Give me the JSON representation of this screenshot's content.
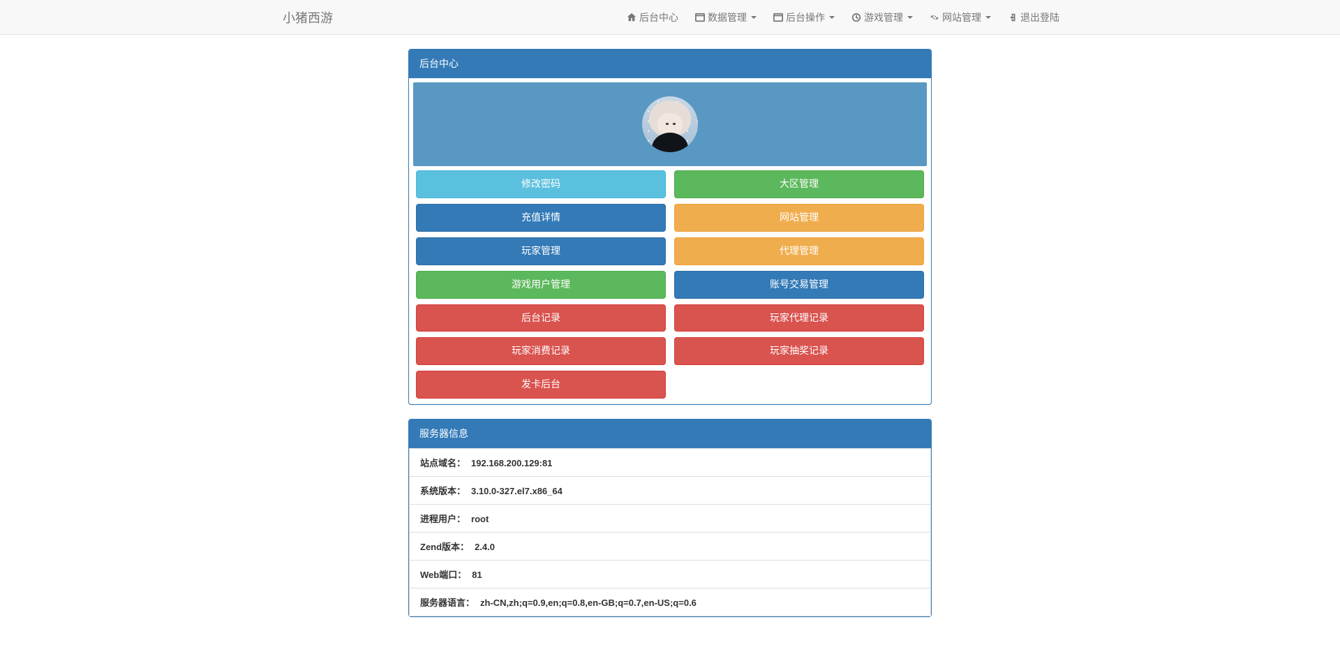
{
  "brand": "小猪西游",
  "nav": {
    "home": "后台中心",
    "data": "数据管理",
    "ops": "后台操作",
    "game": "游戏管理",
    "site": "网站管理",
    "logout": "退出登陆"
  },
  "panel1_title": "后台中心",
  "buttons": {
    "change_pw": "修改密码",
    "zone_mgmt": "大区管理",
    "recharge": "充值详情",
    "site_mgmt": "网站管理",
    "player_mgmt": "玩家管理",
    "agent_mgmt": "代理管理",
    "game_user_mgmt": "游戏用户管理",
    "acct_trade": "账号交易管理",
    "backend_log": "后台记录",
    "player_agent_log": "玩家代理记录",
    "player_consume_log": "玩家消费记录",
    "player_lottery_log": "玩家抽奖记录",
    "card_backend": "发卡后台"
  },
  "server_panel_title": "服务器信息",
  "server": {
    "rows": [
      {
        "label": "站点域名：",
        "value": "192.168.200.129:81"
      },
      {
        "label": "系统版本：",
        "value": "3.10.0-327.el7.x86_64"
      },
      {
        "label": "进程用户：",
        "value": "root"
      },
      {
        "label": "Zend版本：",
        "value": "2.4.0"
      },
      {
        "label": "Web端口：",
        "value": "81"
      },
      {
        "label": "服务器语言：",
        "value": "zh-CN,zh;q=0.9,en;q=0.8,en-GB;q=0.7,en-US;q=0.6"
      }
    ]
  }
}
